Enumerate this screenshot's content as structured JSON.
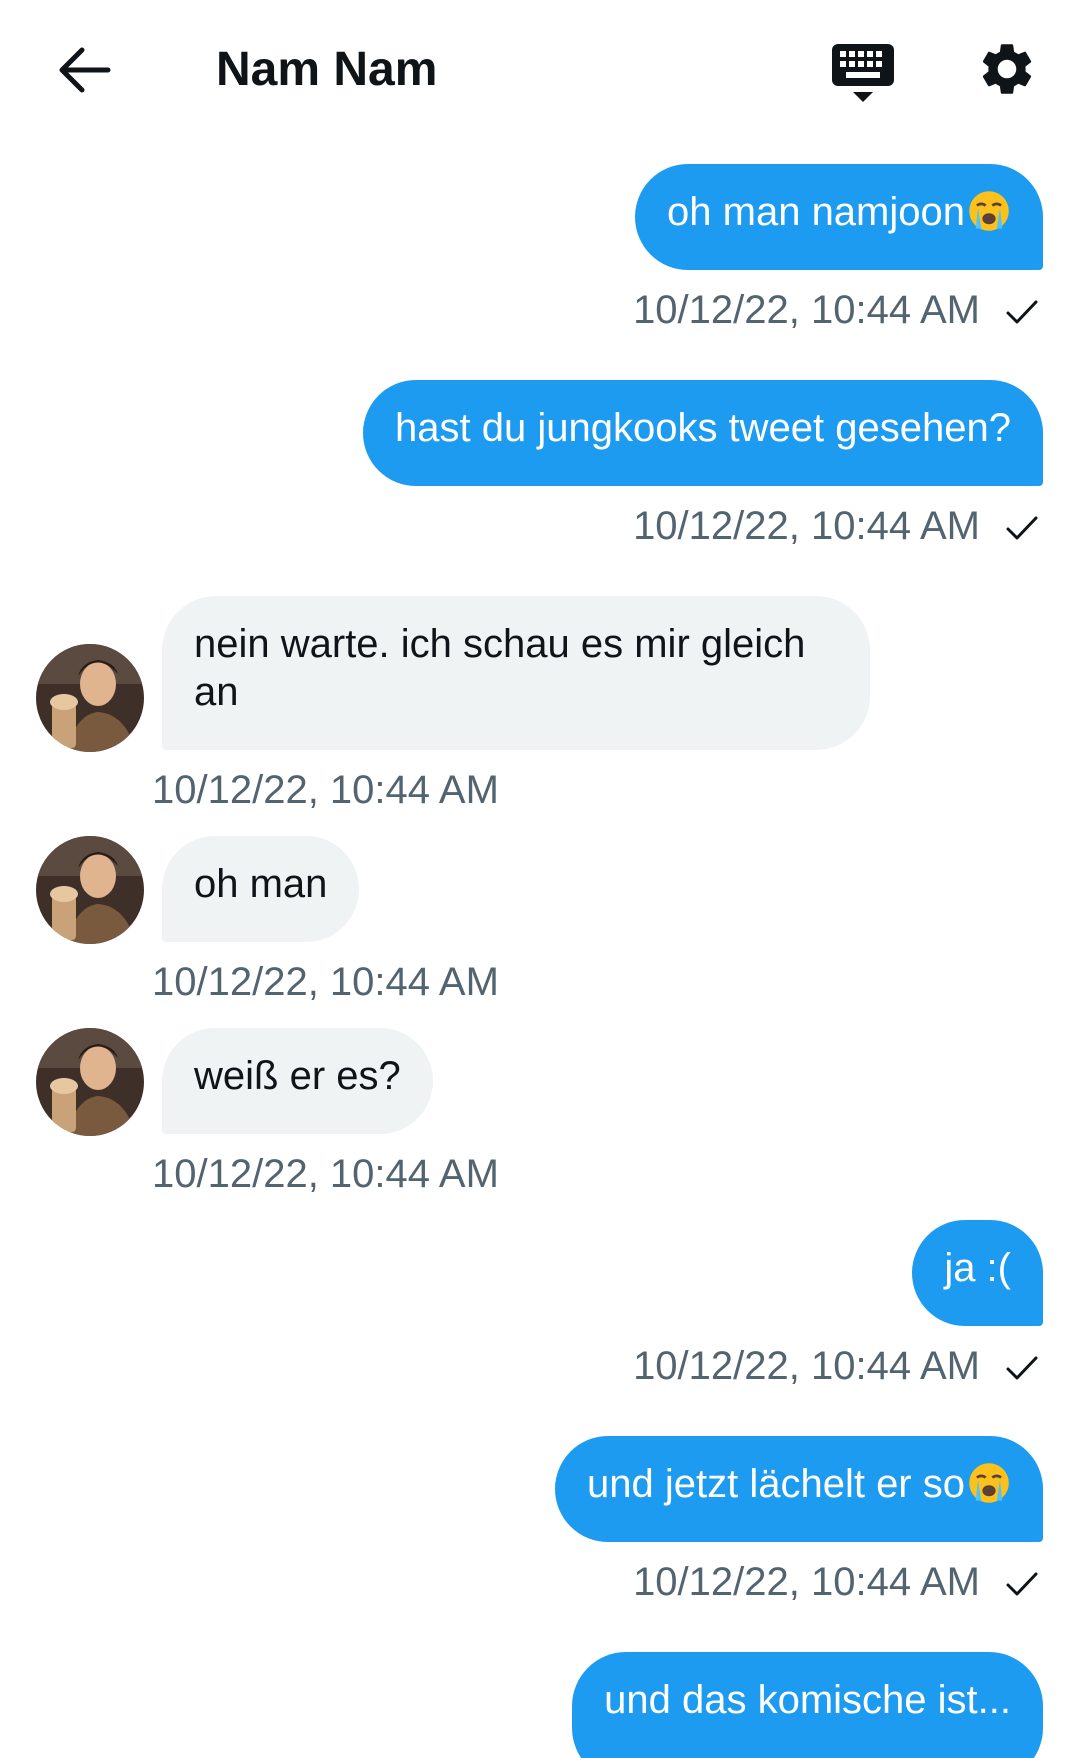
{
  "header": {
    "title": "Nam Nam",
    "back_icon": "arrow-left-icon",
    "keyboard_icon": "keyboard-icon",
    "settings_icon": "gear-icon"
  },
  "colors": {
    "sent_bubble": "#1d9bf0",
    "received_bubble": "#eff3f4",
    "timestamp": "#536471",
    "text": "#0f1419"
  },
  "messages": [
    {
      "direction": "sent",
      "text": "oh man namjoon",
      "emoji": "loudly-crying-face",
      "timestamp": "10/12/22, 10:44 AM",
      "read": true
    },
    {
      "direction": "sent",
      "text": "hast du jungkooks tweet gesehen?",
      "timestamp": "10/12/22, 10:44 AM",
      "read": true
    },
    {
      "direction": "received",
      "text": "nein warte. ich schau es mir gleich an",
      "timestamp": "10/12/22, 10:44 AM"
    },
    {
      "direction": "received",
      "text": "oh man",
      "timestamp": "10/12/22, 10:44 AM"
    },
    {
      "direction": "received",
      "text": "weiß er es?",
      "timestamp": "10/12/22, 10:44 AM"
    },
    {
      "direction": "sent",
      "text": "ja :(",
      "timestamp": "10/12/22, 10:44 AM",
      "read": true
    },
    {
      "direction": "sent",
      "text": "und jetzt lächelt er so",
      "emoji": "loudly-crying-face",
      "timestamp": "10/12/22, 10:44 AM",
      "read": true
    },
    {
      "direction": "sent",
      "text": "und das komische ist..."
    }
  ]
}
